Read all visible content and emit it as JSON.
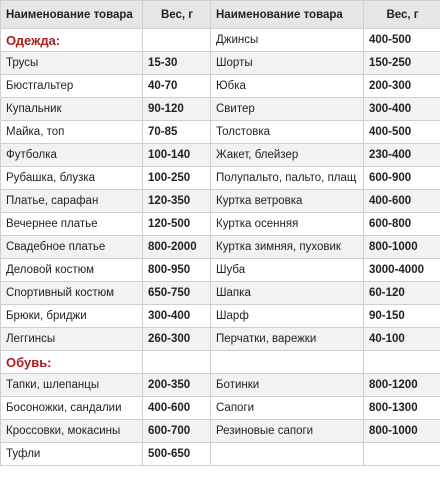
{
  "header": {
    "name1": "Наименование товара",
    "weight1": "Вес, г",
    "name2": "Наименование товара",
    "weight2": "Вес, г"
  },
  "rows": [
    [
      "",
      "",
      "Джинсы",
      "400-500"
    ],
    [
      "Трусы",
      "15-30",
      "Шорты",
      "150-250"
    ],
    [
      "Бюстгальтер",
      "40-70",
      "Юбка",
      "200-300"
    ],
    [
      "Купальник",
      "90-120",
      "Свитер",
      "300-400"
    ],
    [
      "Майка, топ",
      "70-85",
      "Толстовка",
      "400-500"
    ],
    [
      "Футболка",
      "100-140",
      "Жакет, блейзер",
      "230-400"
    ],
    [
      "Рубашка, блузка",
      "100-250",
      "Полупальто, пальто, плащ",
      "600-900"
    ],
    [
      "Платье, сарафан",
      "120-350",
      "Куртка ветровка",
      "400-600"
    ],
    [
      "Вечернее платье",
      "120-500",
      "Куртка осенняя",
      "600-800"
    ],
    [
      "Свадебное платье",
      "800-2000",
      "Куртка зимняя, пуховик",
      "800-1000"
    ],
    [
      "Деловой костюм",
      "800-950",
      "Шуба",
      "3000-4000"
    ],
    [
      "Спортивный костюм",
      "650-750",
      "Шапка",
      "60-120"
    ],
    [
      "Брюки, бриджи",
      "300-400",
      "Шарф",
      "90-150"
    ],
    [
      "Леггинсы",
      "260-300",
      "Перчатки, варежки",
      "40-100"
    ],
    [
      "",
      "",
      "",
      ""
    ],
    [
      "Тапки, шлепанцы",
      "200-350",
      "Ботинки",
      "800-1200"
    ],
    [
      "Босоножки, сандалии",
      "400-600",
      "Сапоги",
      "800-1300"
    ],
    [
      "Кроссовки, мокасины",
      "600-700",
      "Резиновые сапоги",
      "800-1000"
    ],
    [
      "Туфли",
      "500-650",
      "",
      ""
    ]
  ],
  "categories": {
    "clothing": "Одежда:",
    "shoes": "Обувь:"
  }
}
